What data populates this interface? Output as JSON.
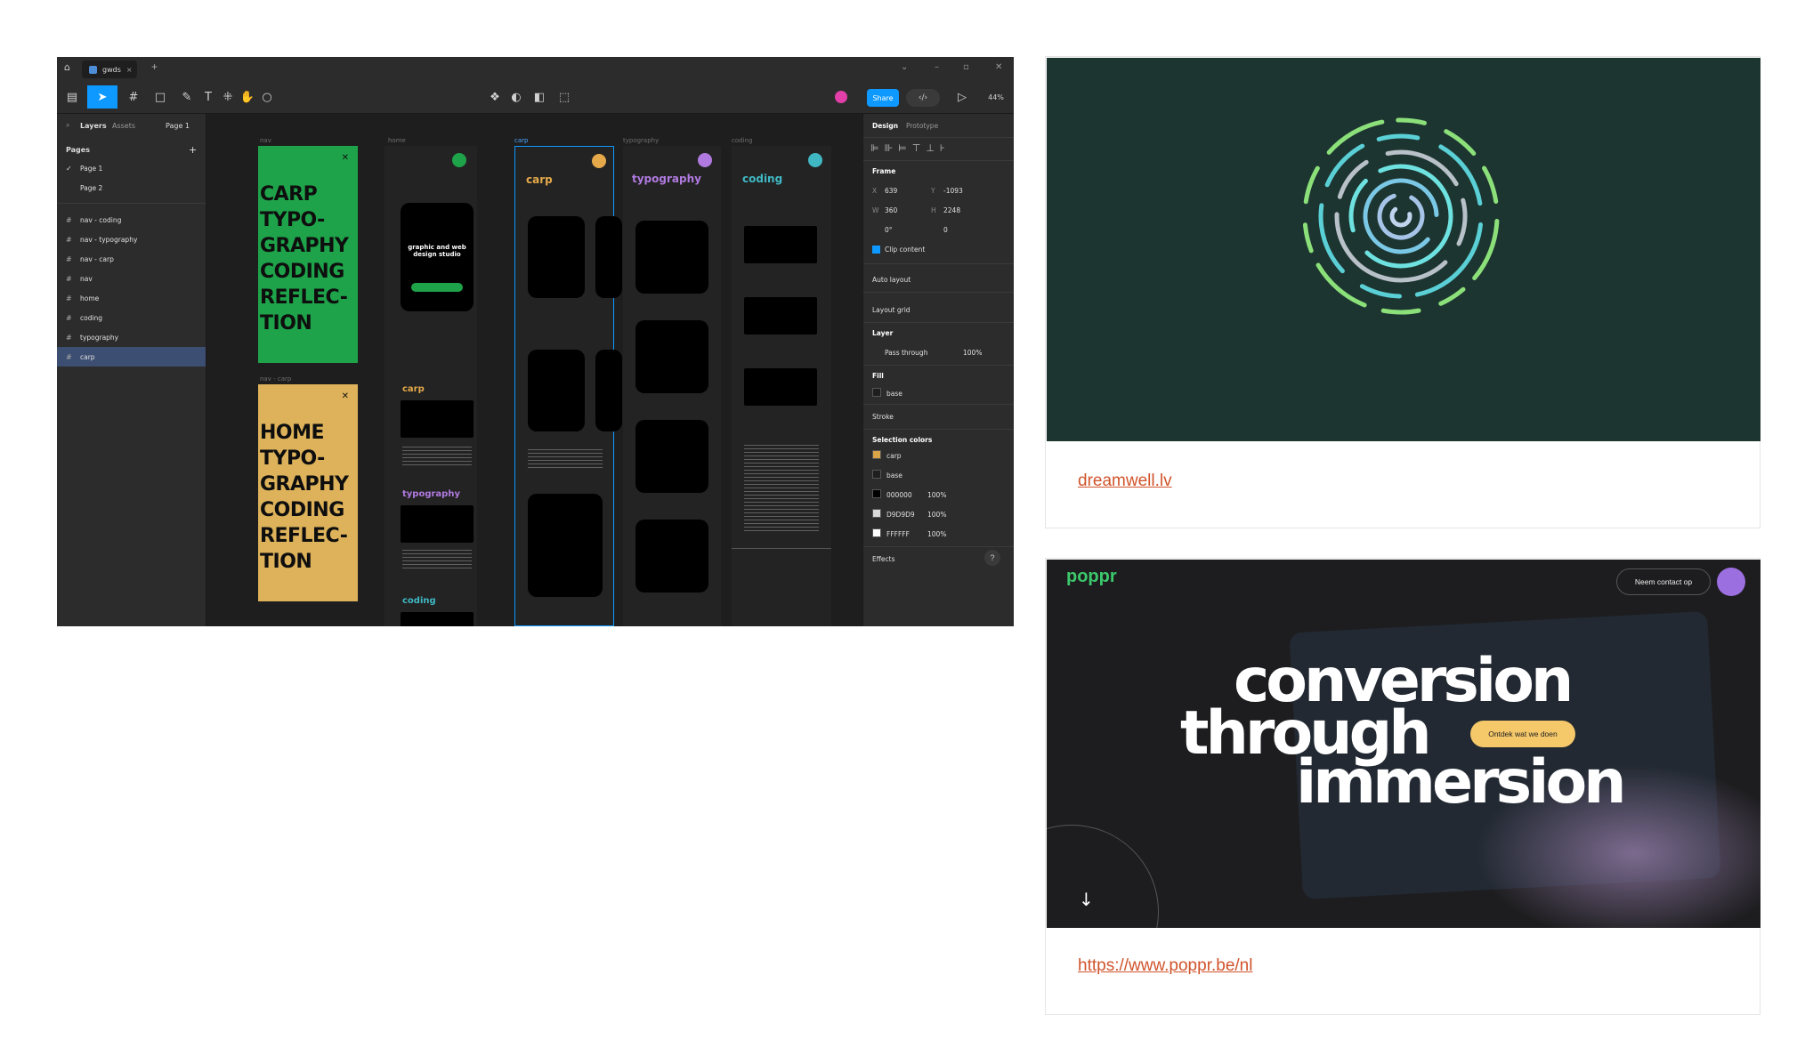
{
  "figma": {
    "tab_label": "gwds",
    "toolbar": {
      "share_label": "Share",
      "zoom": "44%"
    },
    "left_panel": {
      "tabs": {
        "layers": "Layers",
        "assets": "Assets",
        "page_selector": "Page 1"
      },
      "pages_title": "Pages",
      "pages": [
        "Page 1",
        "Page 2"
      ],
      "layers": [
        "nav - coding",
        "nav - typography",
        "nav - carp",
        "nav",
        "home",
        "coding",
        "typography",
        "carp"
      ]
    },
    "canvas": {
      "frame_labels": [
        "nav",
        "home",
        "carp",
        "typography",
        "coding",
        "nav - carp"
      ],
      "green_frame_text": [
        "CARP",
        "TYPO-",
        "GRAPHY",
        "CODING",
        "REFLEC-",
        "TION"
      ],
      "yellow_frame_text": [
        "HOME",
        "TYPO-",
        "GRAPHY",
        "CODING",
        "REFLEC-",
        "TION"
      ],
      "home_phone_text": "graphic and web design studio",
      "col_heads": {
        "carp": "carp",
        "typography": "typography",
        "coding": "coding"
      },
      "home_headings": [
        "carp",
        "typography",
        "coding"
      ],
      "colors": {
        "green": "#1ea34a",
        "yellow": "#ddb25a",
        "carp": "#e5a94a",
        "typography": "#b07ae0",
        "coding": "#3fb8c4"
      }
    },
    "right_panel": {
      "tabs": {
        "design": "Design",
        "prototype": "Prototype"
      },
      "frame_title": "Frame",
      "x": "639",
      "y": "-1093",
      "w": "360",
      "h": "2248",
      "rotation": "0°",
      "radius": "0",
      "clip_content": "Clip content",
      "auto_layout": "Auto layout",
      "layout_grid": "Layout grid",
      "layer_title": "Layer",
      "blend": "Pass through",
      "opacity": "100%",
      "fill_title": "Fill",
      "fill_value": "base",
      "stroke_title": "Stroke",
      "selection_colors_title": "Selection colors",
      "selection_colors": [
        {
          "name": "carp",
          "hex": "#d9a548",
          "opacity": ""
        },
        {
          "name": "base",
          "hex": "#1e1e1e",
          "opacity": ""
        },
        {
          "name": "000000",
          "hex": "#000000",
          "opacity": "100%"
        },
        {
          "name": "D9D9D9",
          "hex": "#d9d9d9",
          "opacity": "100%"
        },
        {
          "name": "FFFFFF",
          "hex": "#ffffff",
          "opacity": "100%"
        }
      ],
      "effects_title": "Effects"
    }
  },
  "cards": [
    {
      "link": "dreamwell.lv"
    },
    {
      "link": "https://www.poppr.be/nl",
      "logo": "poppr",
      "contact_label": "Neem contact op",
      "headline": [
        "conversion",
        "through",
        "immersion"
      ],
      "cta_label": "Ontdek wat we doen"
    }
  ]
}
